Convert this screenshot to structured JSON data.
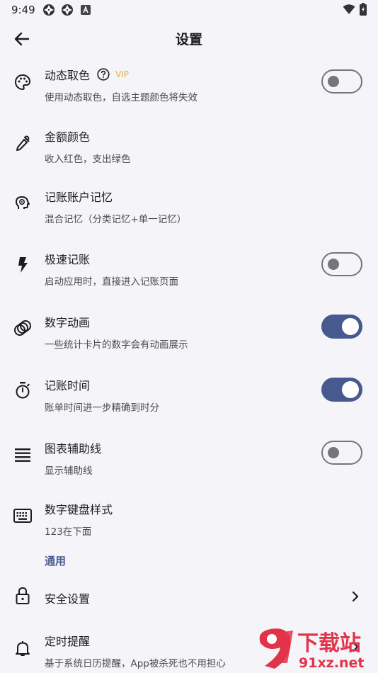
{
  "status": {
    "time": "9:49",
    "left_icons": [
      "aperture-icon",
      "aperture-icon",
      "a-badge-icon"
    ],
    "right_icons": [
      "wifi-icon",
      "battery-icon"
    ]
  },
  "header": {
    "title": "设置"
  },
  "settings": [
    {
      "title": "动态取色",
      "subtitle": "使用动态取色，自选主题颜色将失效",
      "icon": "palette-icon",
      "badge": "VIP",
      "toggle": false
    },
    {
      "title": "金额颜色",
      "subtitle": "收入红色，支出绿色",
      "icon": "eyedropper-icon"
    },
    {
      "title": "记账账户记忆",
      "subtitle": "混合记忆（分类记忆+单一记忆）",
      "icon": "brain-icon"
    },
    {
      "title": "极速记账",
      "subtitle": "启动应用时，直接进入记账页面",
      "icon": "bolt-icon",
      "toggle": false
    },
    {
      "title": "数字动画",
      "subtitle": "一些统计卡片的数字会有动画展示",
      "icon": "rings-icon",
      "toggle": true
    },
    {
      "title": "记账时间",
      "subtitle": "账单时间进一步精确到时分",
      "icon": "stopwatch-icon",
      "toggle": true
    },
    {
      "title": "图表辅助线",
      "subtitle": "显示辅助线",
      "icon": "lines-icon",
      "toggle": false
    },
    {
      "title": "数字键盘样式",
      "subtitle": "123在下面",
      "icon": "keyboard-icon"
    }
  ],
  "section": {
    "label": "通用"
  },
  "general": [
    {
      "title": "安全设置",
      "icon": "lock-icon"
    },
    {
      "title": "定时提醒",
      "subtitle": "基于系统日历提醒，App被杀死也不用担心",
      "icon": "bell-icon"
    }
  ],
  "watermark": {
    "text_main": "下载站",
    "text_url": "91xz.net",
    "color": "#e0344a"
  },
  "colors": {
    "accent": "#465a8f",
    "background": "#f5f4f8",
    "vip": "#e0b03a"
  }
}
